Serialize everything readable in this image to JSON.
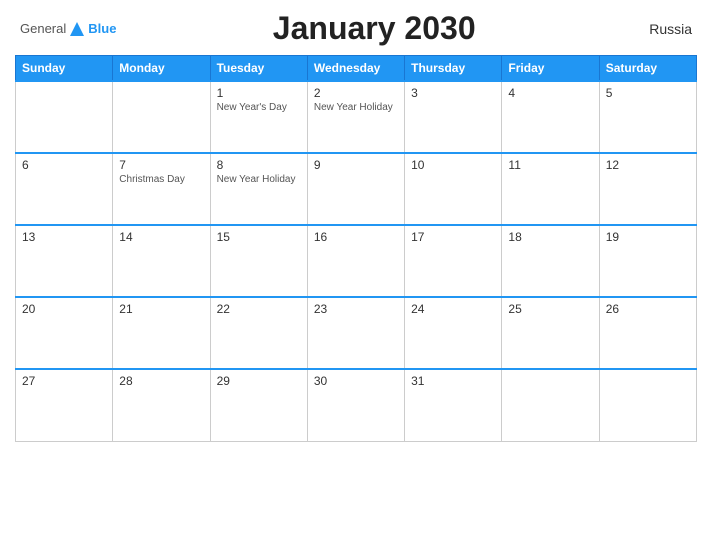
{
  "header": {
    "logo_general": "General",
    "logo_blue": "Blue",
    "title": "January 2030",
    "country": "Russia"
  },
  "columns": [
    "Sunday",
    "Monday",
    "Tuesday",
    "Wednesday",
    "Thursday",
    "Friday",
    "Saturday"
  ],
  "weeks": [
    [
      {
        "day": "",
        "holiday": ""
      },
      {
        "day": "",
        "holiday": ""
      },
      {
        "day": "1",
        "holiday": "New Year's Day"
      },
      {
        "day": "2",
        "holiday": "New Year Holiday"
      },
      {
        "day": "3",
        "holiday": ""
      },
      {
        "day": "4",
        "holiday": ""
      },
      {
        "day": "5",
        "holiday": ""
      }
    ],
    [
      {
        "day": "6",
        "holiday": ""
      },
      {
        "day": "7",
        "holiday": "Christmas Day"
      },
      {
        "day": "8",
        "holiday": "New Year Holiday"
      },
      {
        "day": "9",
        "holiday": ""
      },
      {
        "day": "10",
        "holiday": ""
      },
      {
        "day": "11",
        "holiday": ""
      },
      {
        "day": "12",
        "holiday": ""
      }
    ],
    [
      {
        "day": "13",
        "holiday": ""
      },
      {
        "day": "14",
        "holiday": ""
      },
      {
        "day": "15",
        "holiday": ""
      },
      {
        "day": "16",
        "holiday": ""
      },
      {
        "day": "17",
        "holiday": ""
      },
      {
        "day": "18",
        "holiday": ""
      },
      {
        "day": "19",
        "holiday": ""
      }
    ],
    [
      {
        "day": "20",
        "holiday": ""
      },
      {
        "day": "21",
        "holiday": ""
      },
      {
        "day": "22",
        "holiday": ""
      },
      {
        "day": "23",
        "holiday": ""
      },
      {
        "day": "24",
        "holiday": ""
      },
      {
        "day": "25",
        "holiday": ""
      },
      {
        "day": "26",
        "holiday": ""
      }
    ],
    [
      {
        "day": "27",
        "holiday": ""
      },
      {
        "day": "28",
        "holiday": ""
      },
      {
        "day": "29",
        "holiday": ""
      },
      {
        "day": "30",
        "holiday": ""
      },
      {
        "day": "31",
        "holiday": ""
      },
      {
        "day": "",
        "holiday": ""
      },
      {
        "day": "",
        "holiday": ""
      }
    ]
  ]
}
